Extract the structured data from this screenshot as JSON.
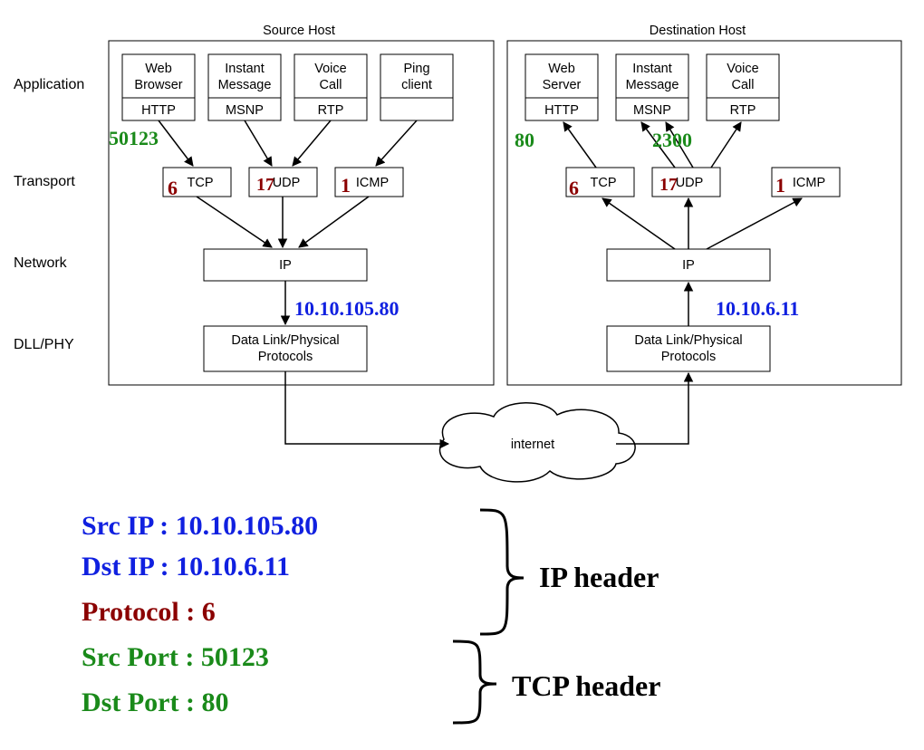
{
  "layers": {
    "l1": "Application",
    "l2": "Transport",
    "l3": "Network",
    "l4": "DLL/PHY"
  },
  "src": {
    "title": "Source Host",
    "apps": [
      {
        "top": "Web",
        "top2": "Browser",
        "bot": "HTTP"
      },
      {
        "top": "Instant",
        "top2": "Message",
        "bot": "MSNP"
      },
      {
        "top": "Voice",
        "top2": "Call",
        "bot": "RTP"
      },
      {
        "top": "Ping",
        "top2": "client",
        "bot": ""
      }
    ],
    "trans": [
      "TCP",
      "UDP",
      "ICMP"
    ],
    "net": "IP",
    "dll": "Data Link/Physical",
    "dll2": "Protocols",
    "port": "50123",
    "protoNums": {
      "tcp": "6",
      "udp": "17",
      "icmp": "1"
    },
    "ip": "10.10.105.80"
  },
  "dst": {
    "title": "Destination Host",
    "apps": [
      {
        "top": "Web",
        "top2": "Server",
        "bot": "HTTP"
      },
      {
        "top": "Instant",
        "top2": "Message",
        "bot": "MSNP"
      },
      {
        "top": "Voice",
        "top2": "Call",
        "bot": "RTP"
      }
    ],
    "trans": [
      "TCP",
      "UDP",
      "ICMP"
    ],
    "net": "IP",
    "dll": "Data Link/Physical",
    "dll2": "Protocols",
    "port1": "80",
    "port2": "2300",
    "protoNums": {
      "tcp": "6",
      "udp": "17",
      "icmp": "1"
    },
    "ip": "10.10.6.11"
  },
  "cloud": "internet",
  "notes": {
    "srcip": "Src IP : 10.10.105.80",
    "dstip": "Dst IP : 10.10.6.11",
    "proto": "Protocol : 6",
    "srcport": "Src Port  : 50123",
    "dstport": "Dst Port :  80",
    "iphdr": "IP  header",
    "tcphdr": "TCP header"
  }
}
